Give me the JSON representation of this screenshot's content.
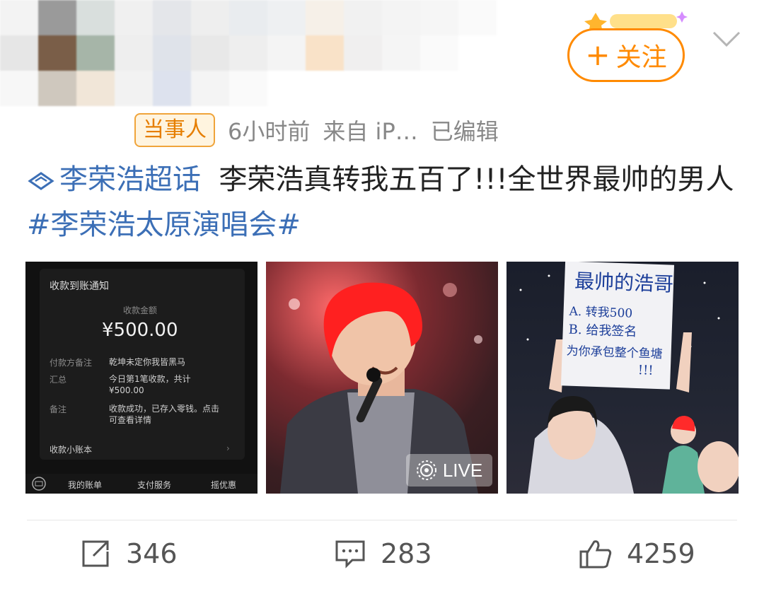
{
  "header": {
    "follow_label": "关注",
    "follow_plus": "+"
  },
  "meta": {
    "badge": "当事人",
    "time": "6小时前",
    "source": "来自 iP…",
    "edited": "已编辑"
  },
  "post": {
    "supertopic": "李荣浩超话",
    "text": "李荣浩真转我五百了!!!全世界最帅的男人",
    "hashtag": "#李荣浩太原演唱会#"
  },
  "images": {
    "payment": {
      "title": "收款到账通知",
      "amount_label": "收款金额",
      "amount": "¥500.00",
      "payer_note_label": "付款方备注",
      "payer_note": "乾坤未定你我皆黑马",
      "summary_label": "汇总",
      "summary_line1": "今日第1笔收款，共计",
      "summary_line2": "¥500.00",
      "remark_label": "备注",
      "remark_line1": "收款成功，已存入零钱。点击",
      "remark_line2": "可查看详情",
      "ledger": "收款小账本",
      "tabs": [
        "我的账单",
        "支付服务",
        "摇优惠"
      ]
    },
    "live_label": "LIVE",
    "sign": {
      "line1": "最帅的浩哥",
      "line2": "A. 转我500",
      "line3": "B. 给我签名",
      "line4": "为你承包整个鱼塘",
      "line5": "!!!"
    }
  },
  "actions": {
    "reposts": "346",
    "comments": "283",
    "likes": "4259"
  },
  "colors": {
    "accent": "#ff8a00",
    "link": "#3c6fb6",
    "badge_border": "#f0a43a"
  }
}
